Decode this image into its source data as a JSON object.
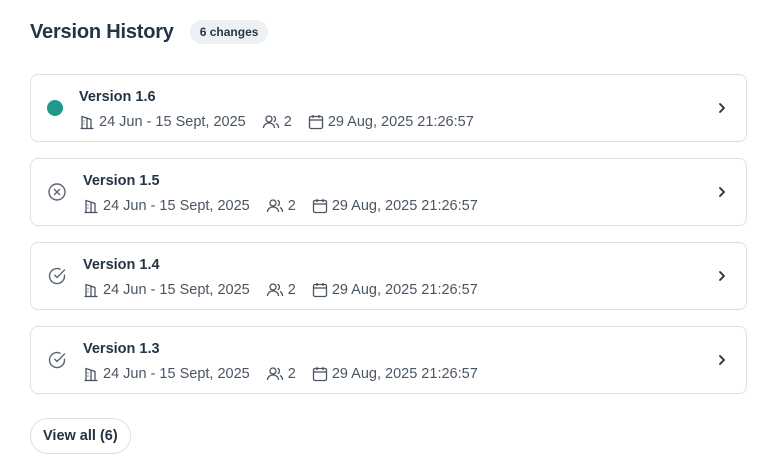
{
  "header": {
    "title": "Version History",
    "badge": "6 changes"
  },
  "versions": [
    {
      "name": "Version 1.6",
      "status": "current",
      "status_icon": "active-dot",
      "status_color": "#1f9a8a",
      "date_range": "24 Jun - 15 Sept, 2025",
      "users": "2",
      "timestamp": "29 Aug, 2025 21:26:57"
    },
    {
      "name": "Version 1.5",
      "status": "rejected",
      "status_icon": "x-circle-icon",
      "date_range": "24 Jun - 15 Sept, 2025",
      "users": "2",
      "timestamp": "29 Aug, 2025 21:26:57"
    },
    {
      "name": "Version 1.4",
      "status": "approved",
      "status_icon": "check-circle-icon",
      "date_range": "24 Jun - 15 Sept, 2025",
      "users": "2",
      "timestamp": "29 Aug, 2025 21:26:57"
    },
    {
      "name": "Version 1.3",
      "status": "approved",
      "status_icon": "check-circle-icon",
      "date_range": "24 Jun - 15 Sept, 2025",
      "users": "2",
      "timestamp": "29 Aug, 2025 21:26:57"
    }
  ],
  "footer": {
    "view_all_label": "View all (6)"
  }
}
